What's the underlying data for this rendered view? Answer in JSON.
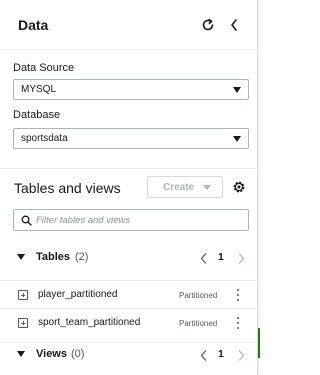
{
  "panel": {
    "title": "Data",
    "refresh_icon": "refresh-icon",
    "collapse_icon": "chevron-left-icon"
  },
  "data_source": {
    "label": "Data Source",
    "value": "MYSQL"
  },
  "database": {
    "label": "Database",
    "value": "sportsdata"
  },
  "tables_and_views": {
    "title": "Tables and views",
    "create_label": "Create",
    "settings_icon": "gear-icon",
    "filter_placeholder": "Filter tables and views"
  },
  "tables": {
    "label": "Tables",
    "count": "(2)",
    "page": "1",
    "items": [
      {
        "name": "player_partitioned",
        "badge": "Partitioned"
      },
      {
        "name": "sport_team_partitioned",
        "badge": "Partitioned"
      }
    ]
  },
  "views": {
    "label": "Views",
    "count": "(0)",
    "page": "1"
  },
  "colors": {
    "border": "#d5dbdb",
    "text": "#16191f",
    "muted": "#545b64",
    "disabled": "#aab7b8",
    "accent_green": "#1d8102"
  }
}
